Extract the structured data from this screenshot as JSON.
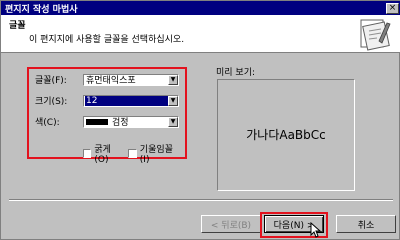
{
  "window": {
    "title": "편지지 작성 마법사",
    "close_label": "×"
  },
  "header": {
    "title": "글꼴",
    "description": "이 편지지에 사용할 글꼴을 선택하십시오."
  },
  "font_options": {
    "font_label": "글꼴(F):",
    "font_value": "휴먼태익스포",
    "size_label": "크기(S):",
    "size_value": "12",
    "color_label": "색(C):",
    "color_value": "검정",
    "bold_label": "굵게(O)",
    "italic_label": "기울임꼴(I)",
    "bold_checked": false,
    "italic_checked": false
  },
  "preview": {
    "label": "미리 보기:",
    "sample_text": "가나다AaBbCc"
  },
  "buttons": {
    "back_label": "< 뒤로(B)",
    "next_label": "다음(N) >",
    "cancel_label": "취소"
  },
  "colors": {
    "highlight": "#e3121e",
    "titlebar": "#000080",
    "face": "#c0c0c0"
  },
  "icons": {
    "wizard": "wizard-stationery-icon",
    "dropdown": "chevron-down-icon",
    "cursor": "mouse-pointer-icon"
  }
}
